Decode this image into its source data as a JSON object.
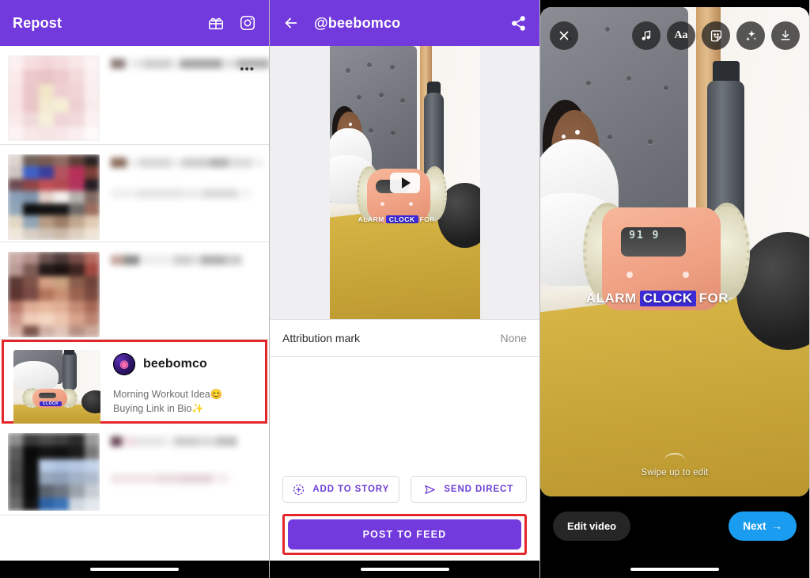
{
  "left_panel": {
    "appbar": {
      "title": "Repost",
      "accent_color": "#7239dd",
      "icons": [
        {
          "name": "gift-card-icon",
          "glyph": "gift"
        },
        {
          "name": "instagram-icon",
          "glyph": "instagram"
        }
      ]
    },
    "list_items": [
      {
        "id": 1,
        "censored": true,
        "tone": "pink"
      },
      {
        "id": 2,
        "censored": true,
        "tone": "mixed"
      },
      {
        "id": 3,
        "censored": true,
        "tone": "warm"
      },
      {
        "id": 5,
        "censored": true,
        "tone": "cool"
      }
    ],
    "selected_item": {
      "username": "beebomco",
      "caption_line1": "Morning Workout Idea😊",
      "caption_line2": "Buying Link in Bio✨",
      "more_text": "· · ·",
      "highlight_color": "#e4262b",
      "avatar_name": "profile-avatar"
    },
    "overflow_glyph": "•••"
  },
  "middle_panel": {
    "appbar": {
      "back_icon": "back-arrow-icon",
      "title": "@beebomco",
      "share_icon": "share-icon",
      "accent_color": "#7239dd"
    },
    "preview": {
      "play_icon": "play-icon",
      "caption_pre": "ALARM",
      "caption_hl": "CLOCK",
      "caption_post": "FOR",
      "clock_digits": "91 9"
    },
    "attribution": {
      "label": "Attribution mark",
      "value": "None"
    },
    "actions": {
      "add_to_story": "ADD TO STORY",
      "add_to_story_icon": "story-plus-icon",
      "send_direct": "SEND DIRECT",
      "send_direct_icon": "send-paperplane-icon",
      "post_to_feed": "POST TO FEED",
      "post_highlight_color": "#e4262b",
      "post_button_color": "#7239dd"
    }
  },
  "right_panel": {
    "top_icons": [
      {
        "name": "close-icon",
        "glyph": "×"
      },
      {
        "name": "music-icon",
        "glyph": "music"
      },
      {
        "name": "text-icon",
        "glyph": "Aa"
      },
      {
        "name": "sticker-icon",
        "glyph": "sticker"
      },
      {
        "name": "effects-sparkle-icon",
        "glyph": "sparkles"
      },
      {
        "name": "download-icon",
        "glyph": "download"
      }
    ],
    "swipe_hint": "Swipe up to edit",
    "edit_video_button": "Edit video",
    "next_button": "Next",
    "next_arrow": "→",
    "next_color": "#1a9df0",
    "caption_pre": "ALARM",
    "caption_hl": "CLOCK",
    "caption_post": "FOR",
    "clock_digits": "91 9"
  }
}
